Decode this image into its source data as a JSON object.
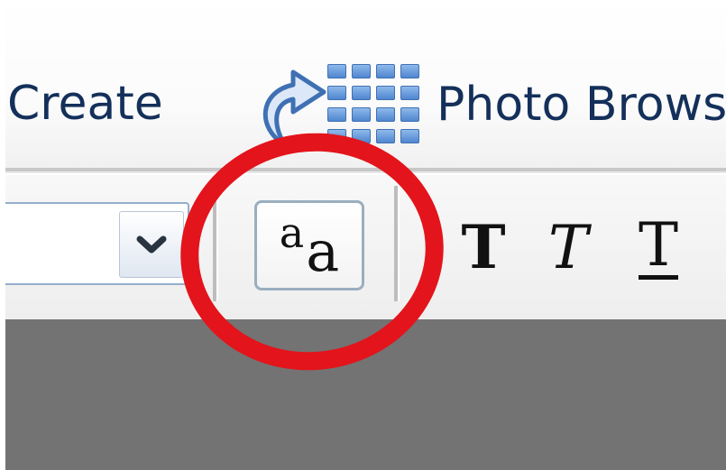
{
  "menu": {
    "create_label": "Create",
    "photo_browser_label": "Photo Brows"
  },
  "toolbar": {
    "font_select_value": "",
    "text_size": {
      "small_glyph": "a",
      "large_glyph": "a"
    },
    "bold_glyph": "T",
    "italic_glyph": "T",
    "underline_glyph": "T"
  },
  "colors": {
    "menu_text": "#14305a",
    "highlight_ring": "#e3141b",
    "workspace": "#737373",
    "grid_tile": "#4f86cf"
  },
  "icons": {
    "photo_browser": "photo-browser-grid-arrow-icon",
    "dropdown": "chevron-down-icon"
  }
}
